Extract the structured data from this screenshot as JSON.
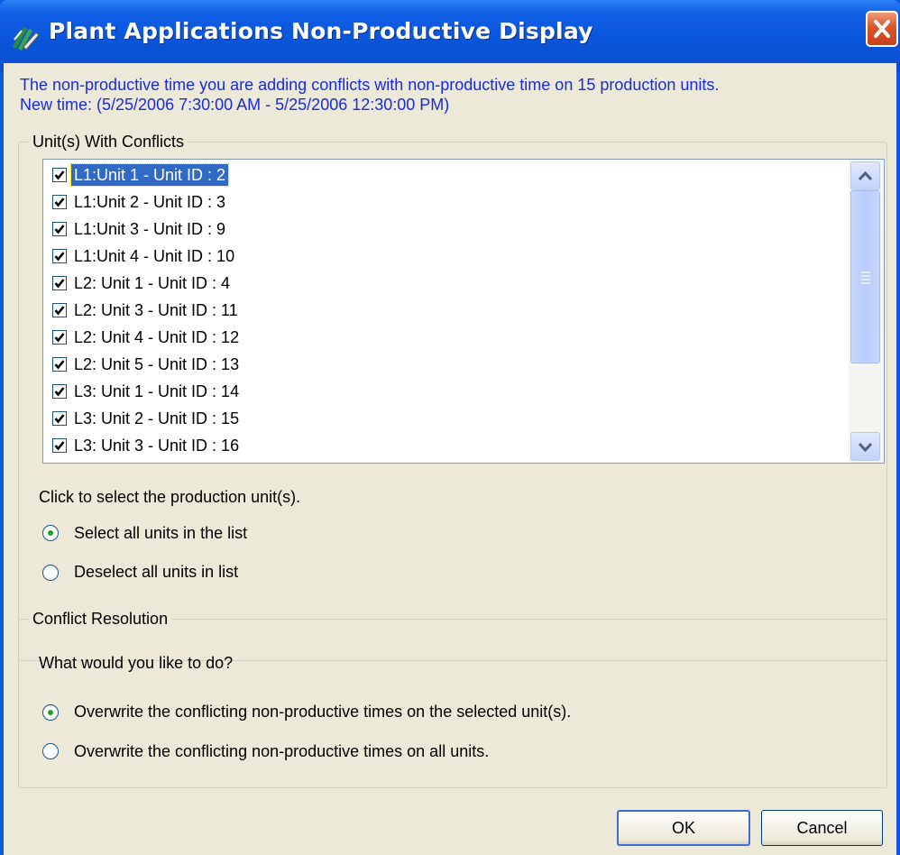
{
  "window": {
    "title": "Plant Applications Non-Productive Display",
    "app_icon": "plant-applications-icon",
    "close_icon": "close-icon"
  },
  "message": {
    "line1": "The non-productive time you are adding conflicts with non-productive time on 15 production units.",
    "line2": "New time:  (5/25/2006 7:30:00 AM - 5/25/2006 12:30:00 PM)"
  },
  "units_group": {
    "legend": "Unit(s) With Conflicts",
    "items": [
      {
        "label": "L1:Unit 1 - Unit ID : 2",
        "checked": true,
        "selected": true
      },
      {
        "label": "L1:Unit 2 - Unit ID : 3",
        "checked": true,
        "selected": false
      },
      {
        "label": "L1:Unit 3 - Unit ID : 9",
        "checked": true,
        "selected": false
      },
      {
        "label": "L1:Unit 4 - Unit ID : 10",
        "checked": true,
        "selected": false
      },
      {
        "label": "L2: Unit 1 - Unit ID : 4",
        "checked": true,
        "selected": false
      },
      {
        "label": "L2: Unit 3 - Unit ID : 11",
        "checked": true,
        "selected": false
      },
      {
        "label": "L2: Unit 4 - Unit ID : 12",
        "checked": true,
        "selected": false
      },
      {
        "label": "L2: Unit 5 - Unit ID : 13",
        "checked": true,
        "selected": false
      },
      {
        "label": "L3: Unit 1 - Unit ID : 14",
        "checked": true,
        "selected": false
      },
      {
        "label": "L3: Unit 2 - Unit ID : 15",
        "checked": true,
        "selected": false
      },
      {
        "label": "L3: Unit 3 - Unit ID : 16",
        "checked": true,
        "selected": false
      }
    ],
    "instruction": "Click to select the production unit(s).",
    "radio_select_all": {
      "label": "Select all units in the list",
      "checked": true
    },
    "radio_deselect_all": {
      "label": "Deselect all units in list",
      "checked": false
    }
  },
  "resolution_group": {
    "legend": "Conflict Resolution",
    "question": "What would you like to do?",
    "radio_selected_units": {
      "label": "Overwrite the conflicting non-productive times on the selected unit(s).",
      "checked": true
    },
    "radio_all_units": {
      "label": "Overwrite the conflicting non-productive times on all units.",
      "checked": false
    }
  },
  "buttons": {
    "ok": "OK",
    "cancel": "Cancel"
  },
  "colors": {
    "title_bar": "#0a54d8",
    "message_text": "#1a2cd8",
    "selection": "#316ac5",
    "dialog_bg": "#ece9d8"
  }
}
